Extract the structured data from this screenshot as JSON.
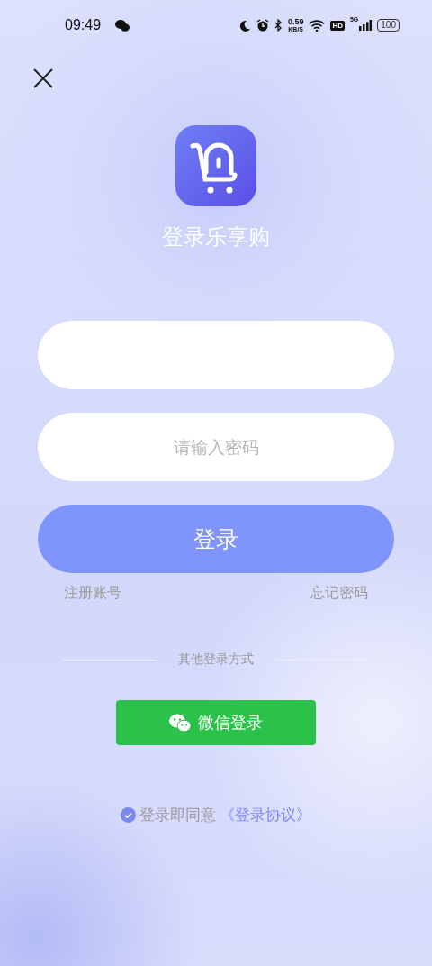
{
  "status_bar": {
    "time": "09:49",
    "net_speed": "0.59",
    "net_unit": "KB/S",
    "hd": "HD",
    "network": "5G",
    "battery": "100"
  },
  "app": {
    "title": "登录乐享购"
  },
  "form": {
    "password": {
      "placeholder": "请输入密码"
    },
    "submit": "登录",
    "register_link": "注册账号",
    "forgot_link": "忘记密码"
  },
  "other_login": {
    "label": "其他登录方式",
    "wechat_button": "微信登录"
  },
  "agreement": {
    "checked": true,
    "text": "登录即同意",
    "link": "《登录协议》"
  }
}
